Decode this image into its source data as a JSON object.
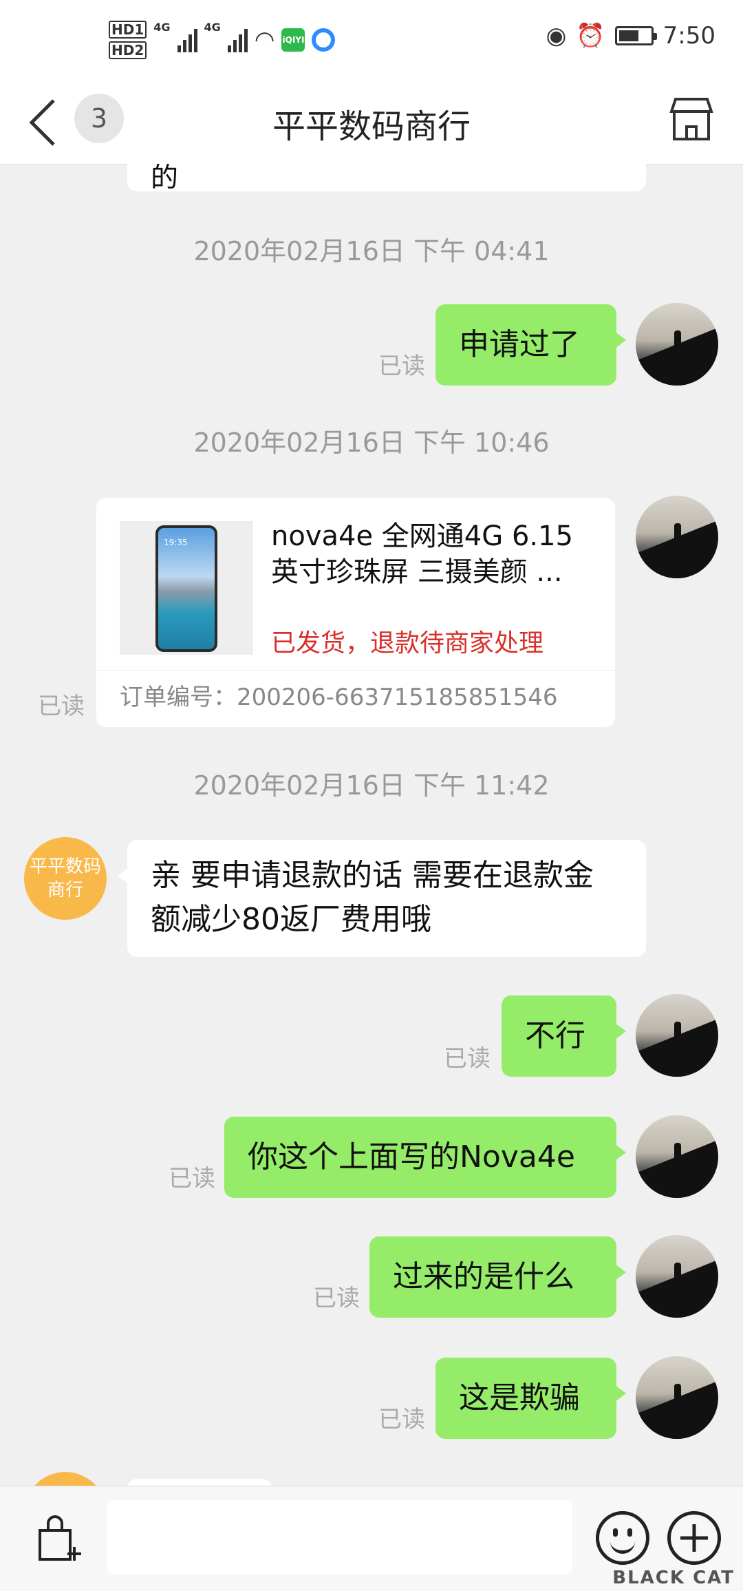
{
  "status_bar": {
    "hd1": "HD1",
    "hd2": "HD2",
    "net1": "4G",
    "net2": "4G",
    "app_icon_text": "iQIYI",
    "time": "7:50",
    "battery_level": 0.65
  },
  "header": {
    "unread_count": "3",
    "title": "平平数码商行"
  },
  "chat": {
    "partial_top_text": "的",
    "messages": [
      {
        "type": "timestamp",
        "text": "2020年02月16日 下午 04:41"
      },
      {
        "type": "sent",
        "text": "申请过了",
        "status": "已读"
      },
      {
        "type": "timestamp",
        "text": "2020年02月16日 下午 10:46"
      },
      {
        "type": "product_card",
        "status": "已读",
        "title": "nova4e 全网通4G 6.15英寸珍珠屏 三摄美颜 ...",
        "order_status": "已发货，退款待商家处理",
        "order_no": "订单编号：200206-663715185851546",
        "thumb_time": "19:35"
      },
      {
        "type": "timestamp",
        "text": "2020年02月16日 下午 11:42"
      },
      {
        "type": "received",
        "sender_avatar": "平平数码商行",
        "text": "亲 要申请退款的话 需要在退款金额减少80返厂费用哦"
      },
      {
        "type": "sent",
        "text": "不行",
        "status": "已读"
      },
      {
        "type": "sent",
        "text": "你这个上面写的Nova4e",
        "status": "已读"
      },
      {
        "type": "sent",
        "text": "过来的是什么",
        "status": "已读"
      },
      {
        "type": "sent",
        "text": "这是欺骗",
        "status": "已读"
      }
    ]
  },
  "input_bar": {
    "placeholder": "",
    "watermark": "BLACK CAT"
  }
}
